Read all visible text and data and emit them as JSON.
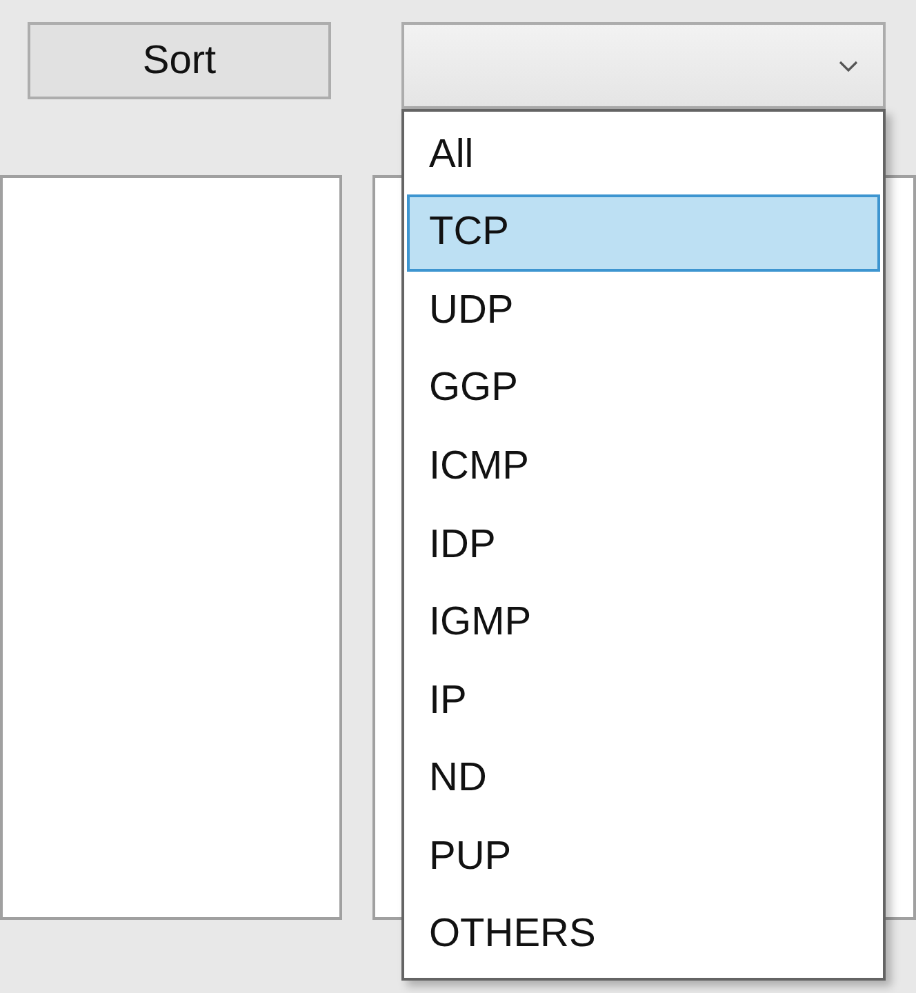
{
  "sort_button": {
    "label": "Sort"
  },
  "protocol_dropdown": {
    "expanded": true,
    "options": [
      {
        "label": "All",
        "selected": false
      },
      {
        "label": "TCP",
        "selected": true
      },
      {
        "label": "UDP",
        "selected": false
      },
      {
        "label": "GGP",
        "selected": false
      },
      {
        "label": "ICMP",
        "selected": false
      },
      {
        "label": "IDP",
        "selected": false
      },
      {
        "label": "IGMP",
        "selected": false
      },
      {
        "label": "IP",
        "selected": false
      },
      {
        "label": "ND",
        "selected": false
      },
      {
        "label": "PUP",
        "selected": false
      },
      {
        "label": "OTHERS",
        "selected": false
      }
    ]
  }
}
